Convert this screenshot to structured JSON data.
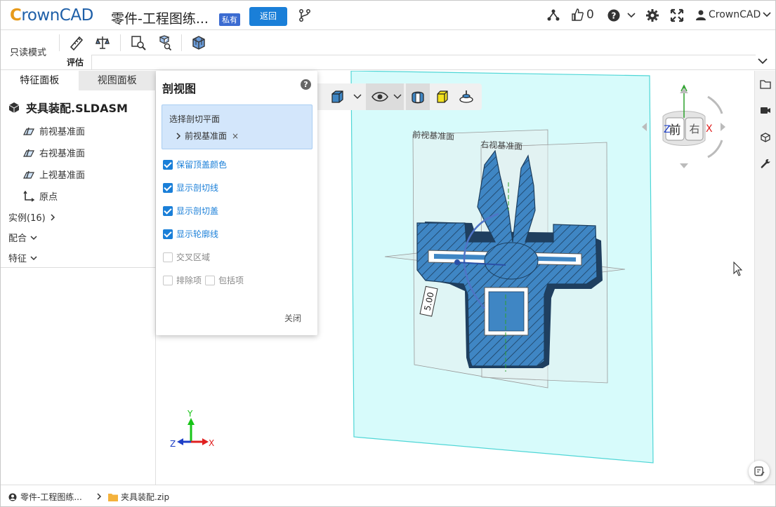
{
  "header": {
    "brand": "rownCAD",
    "brand_initial": "C",
    "doc_title": "零件-工程图练...",
    "private_badge": "私有",
    "back_button": "返回",
    "likes_count": "0",
    "user_name": "CrownCAD"
  },
  "toolbar": {
    "mode_label": "只读模式",
    "tab_label": "评估"
  },
  "left_panel": {
    "tabs": [
      "特征面板",
      "视图面板"
    ],
    "assembly_title": "夹具装配.SLDASM",
    "tree_items": [
      "前视基准面",
      "右视基准面",
      "上视基准面",
      "原点"
    ],
    "groups": [
      "实例(16)",
      "配合",
      "特征"
    ]
  },
  "dialog": {
    "title": "剖视图",
    "help": "?",
    "plane_label": "选择剖切平面",
    "plane_value": "前视基准面",
    "plane_remove": "×",
    "options": [
      {
        "label": "保留顶盖颜色",
        "checked": true
      },
      {
        "label": "显示剖切线",
        "checked": true
      },
      {
        "label": "显示剖切盖",
        "checked": true
      },
      {
        "label": "显示轮廓线",
        "checked": true
      },
      {
        "label": "交叉区域",
        "checked": false
      }
    ],
    "exclude_label": "排除项",
    "include_label": "包括项",
    "close": "关闭"
  },
  "viewport": {
    "plane_front_label": "前视基准面",
    "plane_right_label": "右视基准面",
    "dimension": "5.00",
    "cube_front": "前",
    "cube_right": "右",
    "cube_axis_z": "Z",
    "cube_axis_x": "X",
    "triad_x": "X",
    "triad_y": "Y",
    "triad_z": "Z"
  },
  "statusbar": {
    "project": "零件-工程图练...",
    "file": "夹具装配.zip"
  },
  "colors": {
    "accent": "#1a7fd8",
    "part_blue": "#3f86c4",
    "plane_cyan": "#bff5f5"
  }
}
